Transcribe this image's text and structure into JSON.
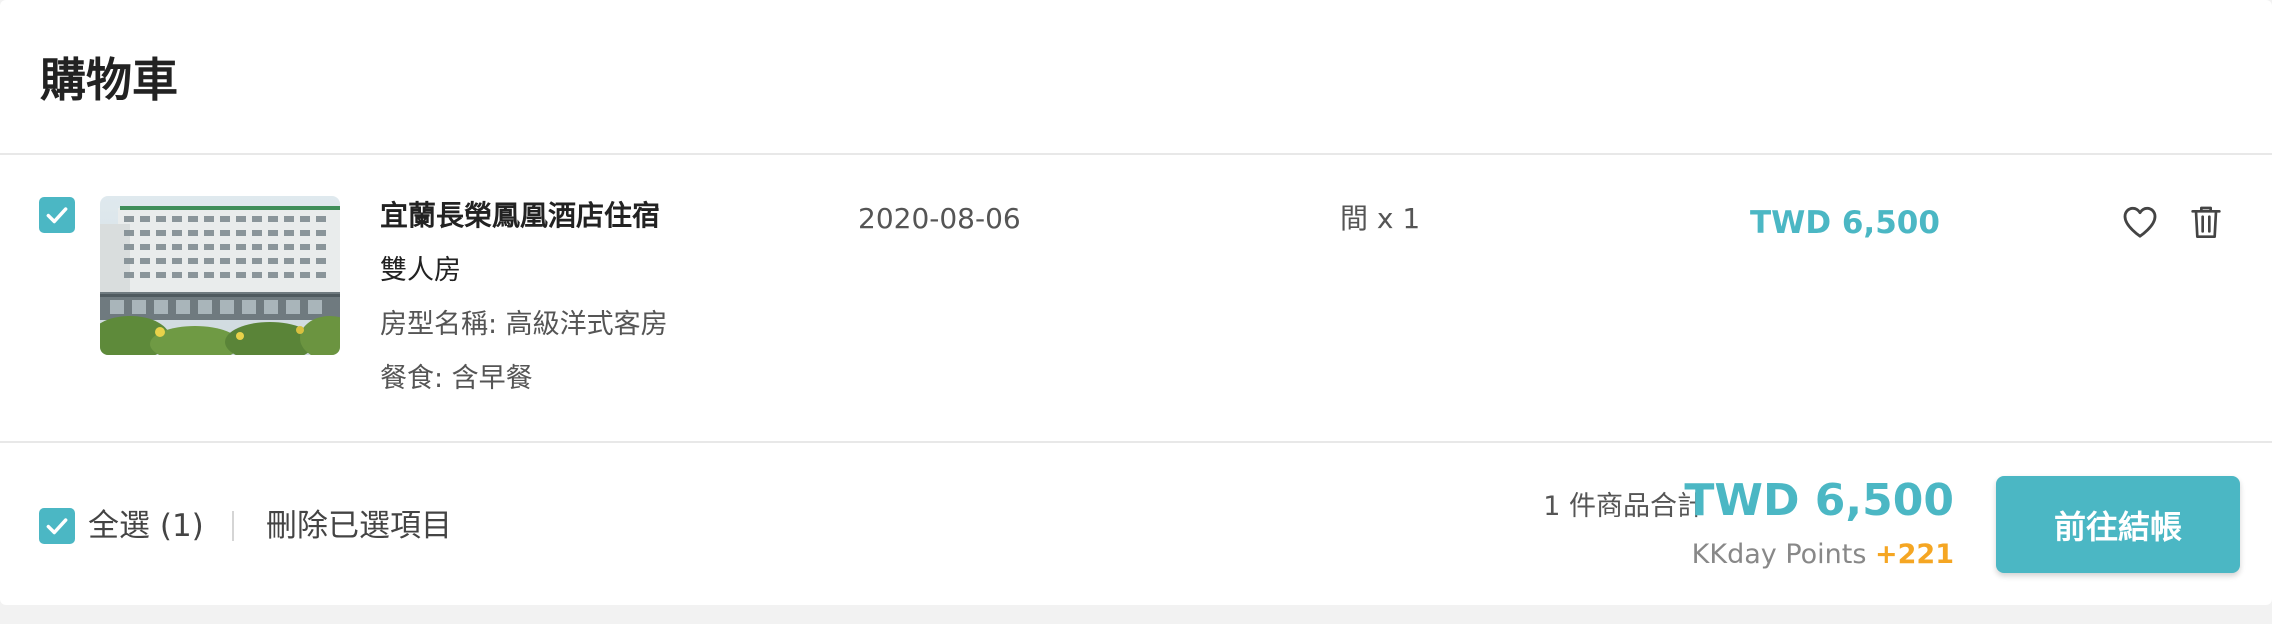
{
  "header": {
    "title": "購物車"
  },
  "item": {
    "checked": true,
    "image_icon": "hotel-photo",
    "name": "宜蘭長榮鳳凰酒店住宿",
    "room_type": "雙人房",
    "room_name": "房型名稱: 高級洋式客房",
    "meal": "餐食: 含早餐",
    "date": "2020-08-06",
    "quantity": "間 x 1",
    "price": "TWD 6,500",
    "favorite_icon": "heart-icon",
    "delete_icon": "trash-icon"
  },
  "footer": {
    "select_all_label": "全選 (1)",
    "delete_selected_label": "刪除已選項目",
    "summary_label": "1 件商品合計",
    "total": "TWD 6,500",
    "points_label": "KKday Points",
    "points_value": "+221",
    "checkout_label": "前往結帳"
  },
  "colors": {
    "accent": "#4bb7c4",
    "points": "#f5a623",
    "background": "#f2f2f2"
  }
}
